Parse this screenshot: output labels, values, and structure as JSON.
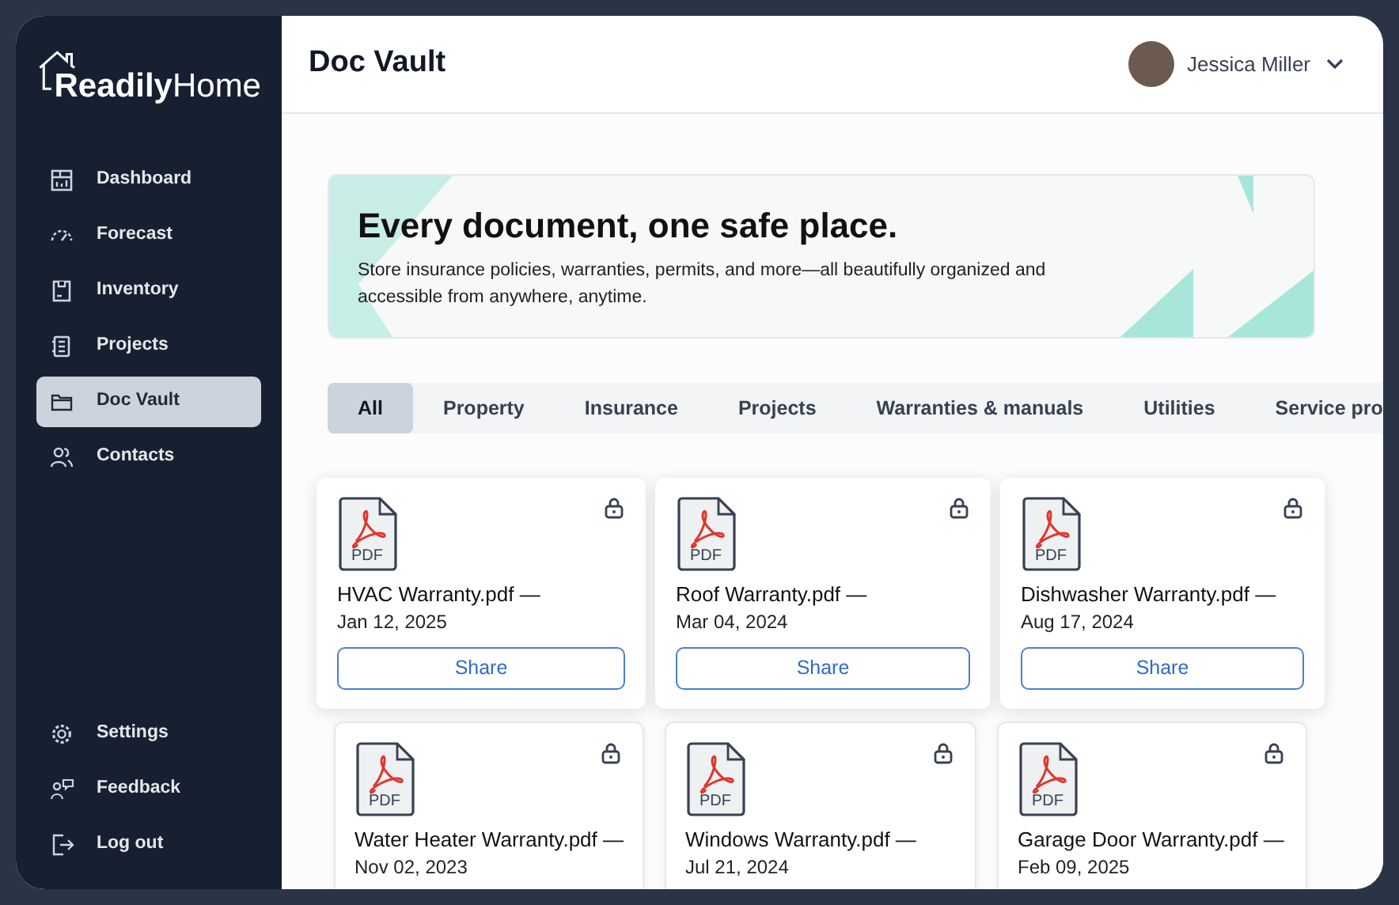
{
  "logo": {
    "part_1": "Readily",
    "part_2": "Home"
  },
  "sidebar": {
    "items": [
      {
        "kind": "dashboard",
        "label": "Dashboard",
        "selected": false
      },
      {
        "kind": "forecast",
        "label": "Forecast",
        "selected": false
      },
      {
        "kind": "inventory",
        "label": "Inventory",
        "selected": false
      },
      {
        "kind": "projects",
        "label": "Projects",
        "selected": false
      },
      {
        "kind": "folder",
        "label": "Doc Vault",
        "selected": true
      },
      {
        "kind": "contacts",
        "label": "Contacts",
        "selected": false
      }
    ],
    "bottom_items": [
      {
        "kind": "settings",
        "label": "Settings"
      },
      {
        "kind": "feedback",
        "label": "Feedback"
      },
      {
        "kind": "logout",
        "label": "Log out"
      }
    ]
  },
  "header": {
    "title": "Doc Vault",
    "user": "Jessica Miller"
  },
  "banner": {
    "title": "Every document, one safe place.",
    "text": "Store insurance policies, warranties, permits, and more—all beautifully organized and accessible from anywhere, anytime."
  },
  "tabs": [
    {
      "label": "All",
      "selected": true
    },
    {
      "label": "Property",
      "selected": false
    },
    {
      "label": "Insurance",
      "selected": false
    },
    {
      "label": "Projects",
      "selected": false
    },
    {
      "label": "Warranties & manuals",
      "selected": false
    },
    {
      "label": "Utilities",
      "selected": false
    },
    {
      "label": "Service pro",
      "selected": false
    }
  ],
  "documents": [
    {
      "file_type": "PDF",
      "name": "HVAC Warranty.pdf —",
      "date": "Jan 12, 2025",
      "button": "Share"
    },
    {
      "file_type": "PDF",
      "name": "Roof Warranty.pdf —",
      "date": "Mar 04, 2024",
      "button": "Share"
    },
    {
      "file_type": "PDF",
      "name": "Dishwasher Warranty.pdf —",
      "date": "Aug 17, 2024",
      "button": "Share"
    },
    {
      "file_type": "PDF",
      "name": "Water Heater Warranty.pdf —",
      "date": "Nov 02, 2023"
    },
    {
      "file_type": "PDF",
      "name": "Windows Warranty.pdf —",
      "date": "Jul 21, 2024"
    },
    {
      "file_type": "PDF",
      "name": "Garage Door Warranty.pdf —",
      "date": "Feb 09, 2025"
    }
  ]
}
